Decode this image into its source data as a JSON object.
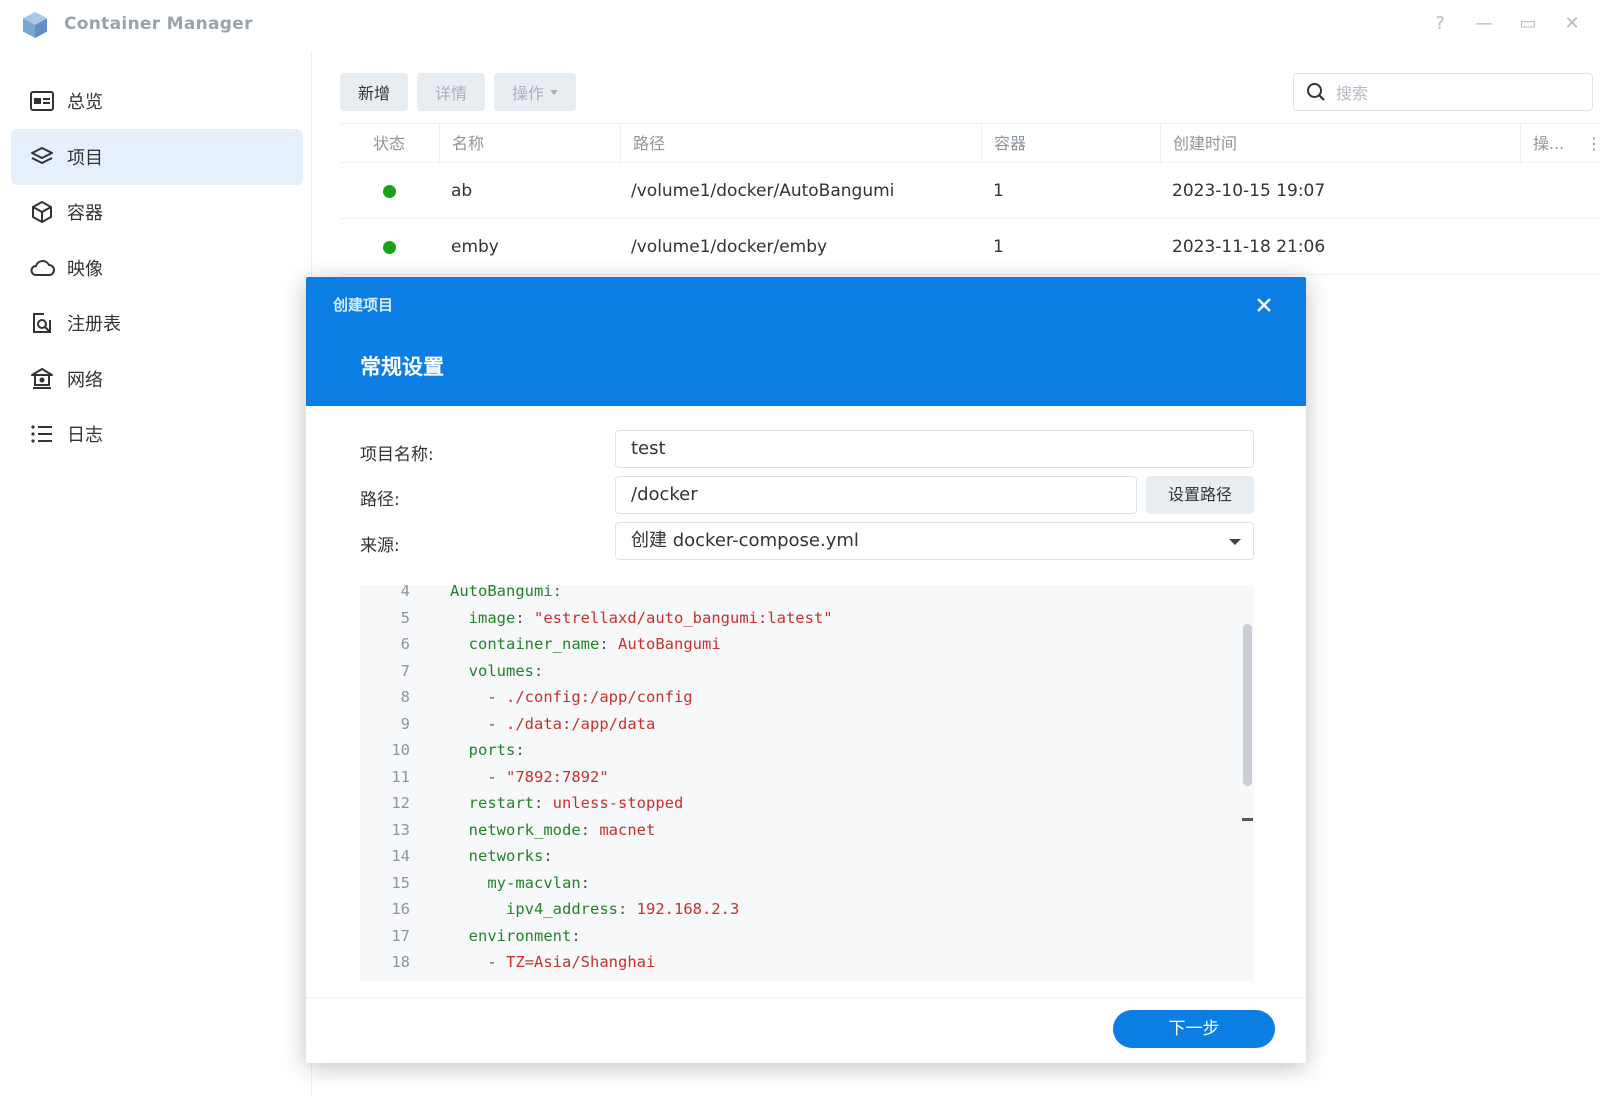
{
  "app": {
    "title": "Container Manager",
    "logo": "container-manager-logo"
  },
  "window_controls": [
    {
      "name": "help-icon",
      "glyph": "?"
    },
    {
      "name": "minimize-icon",
      "glyph": "—"
    },
    {
      "name": "maximize-icon",
      "glyph": "▭"
    },
    {
      "name": "close-icon",
      "glyph": "✕"
    }
  ],
  "sidebar": {
    "items": [
      {
        "label": "总览",
        "icon": "overview-icon",
        "active": false
      },
      {
        "label": "项目",
        "icon": "layers-icon",
        "active": true
      },
      {
        "label": "容器",
        "icon": "cube-icon",
        "active": false
      },
      {
        "label": "映像",
        "icon": "cloud-icon",
        "active": false
      },
      {
        "label": "注册表",
        "icon": "registry-search-icon",
        "active": false
      },
      {
        "label": "网络",
        "icon": "network-icon",
        "active": false
      },
      {
        "label": "日志",
        "icon": "list-icon",
        "active": false
      }
    ]
  },
  "toolbar": {
    "add_label": "新增",
    "details_label": "详情",
    "actions_label": "操作",
    "search_placeholder": "搜索"
  },
  "table": {
    "headers": [
      "状态",
      "名称",
      "路径",
      "容器",
      "创建时间",
      "操..."
    ],
    "rows": [
      {
        "status": "running",
        "name": "ab",
        "path": "/volume1/docker/AutoBangumi",
        "containers": "1",
        "created": "2023-10-15 19:07"
      },
      {
        "status": "running",
        "name": "emby",
        "path": "/volume1/docker/emby",
        "containers": "1",
        "created": "2023-11-18 21:06"
      }
    ]
  },
  "colors": {
    "accent": "#0a7ee2",
    "status_running": "#1aa31a",
    "yaml_key": "#25822b",
    "yaml_value": "#c9302c"
  },
  "dialog": {
    "title": "创建项目",
    "subtitle": "常规设置",
    "fields": {
      "name_label": "项目名称:",
      "name_value": "test",
      "path_label": "路径:",
      "path_value": "/docker",
      "set_path_label": "设置路径",
      "source_label": "来源:",
      "source_value": "创建 docker-compose.yml"
    },
    "code_lines": [
      {
        "n": "4",
        "indent": "",
        "key": "AutoBangumi",
        "sep": ":",
        "val": ""
      },
      {
        "n": "5",
        "indent": "  ",
        "key": "image",
        "sep": ": ",
        "val": "\"estrellaxd/auto_bangumi:latest\""
      },
      {
        "n": "6",
        "indent": "  ",
        "key": "container_name",
        "sep": ": ",
        "val": "AutoBangumi"
      },
      {
        "n": "7",
        "indent": "  ",
        "key": "volumes",
        "sep": ":",
        "val": ""
      },
      {
        "n": "8",
        "indent": "    ",
        "key": "",
        "sep": "- ",
        "val": "./config:/app/config"
      },
      {
        "n": "9",
        "indent": "    ",
        "key": "",
        "sep": "- ",
        "val": "./data:/app/data"
      },
      {
        "n": "10",
        "indent": "  ",
        "key": "ports",
        "sep": ":",
        "val": ""
      },
      {
        "n": "11",
        "indent": "    ",
        "key": "",
        "sep": "- ",
        "val": "\"7892:7892\""
      },
      {
        "n": "12",
        "indent": "  ",
        "key": "restart",
        "sep": ": ",
        "val": "unless-stopped"
      },
      {
        "n": "13",
        "indent": "  ",
        "key": "network_mode",
        "sep": ": ",
        "val": "macnet"
      },
      {
        "n": "14",
        "indent": "  ",
        "key": "networks",
        "sep": ":",
        "val": ""
      },
      {
        "n": "15",
        "indent": "    ",
        "key": "my-macvlan",
        "sep": ":",
        "val": ""
      },
      {
        "n": "16",
        "indent": "      ",
        "key": "ipv4_address",
        "sep": ": ",
        "val": "192.168.2.3"
      },
      {
        "n": "17",
        "indent": "  ",
        "key": "environment",
        "sep": ":",
        "val": ""
      },
      {
        "n": "18",
        "indent": "    ",
        "key": "",
        "sep": "- ",
        "val": "TZ=Asia/Shanghai"
      }
    ],
    "next_label": "下一步"
  }
}
